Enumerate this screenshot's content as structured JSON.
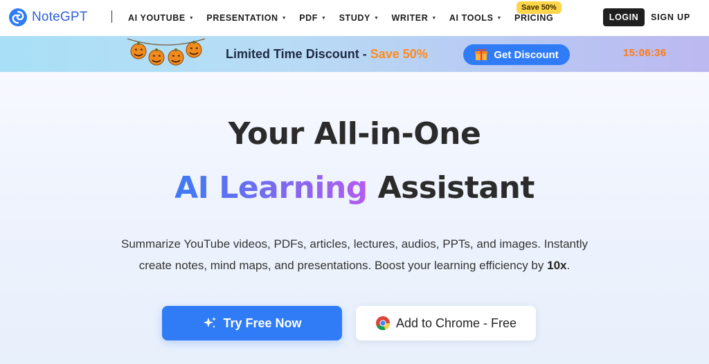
{
  "brand": {
    "name": "NoteGPT"
  },
  "nav": {
    "items": [
      {
        "label": "AI YOUTUBE",
        "has_dropdown": true
      },
      {
        "label": "PRESENTATION",
        "has_dropdown": true
      },
      {
        "label": "PDF",
        "has_dropdown": true
      },
      {
        "label": "STUDY",
        "has_dropdown": true
      },
      {
        "label": "WRITER",
        "has_dropdown": true
      },
      {
        "label": "AI TOOLS",
        "has_dropdown": true
      },
      {
        "label": "PRICING",
        "has_dropdown": false
      }
    ],
    "pricing_badge": "Save 50%",
    "login": "LOGIN",
    "signup": "SIGN UP"
  },
  "promo": {
    "text": "Limited Time Discount - ",
    "highlight": "Save 50%",
    "button": "Get Discount",
    "timer": "15:06:36",
    "decoration_icon": "halloween-pumpkins",
    "button_icon": "gift-icon"
  },
  "hero": {
    "title_line1": "Your All-in-One",
    "title_gradient": "AI Learning",
    "title_rest": " Assistant",
    "subtitle_line1": "Summarize YouTube videos, PDFs, articles, lectures, audios, PPTs, and images. Instantly",
    "subtitle_line2_prefix": "create notes, mind maps, and presentations. Boost your learning efficiency by ",
    "subtitle_line2_bold": "10x",
    "subtitle_line2_suffix": ".",
    "primary_button": "Try Free Now",
    "primary_icon": "sparkle-icon",
    "secondary_button": "Add to Chrome - Free",
    "secondary_icon": "chrome-icon"
  },
  "colors": {
    "accent_blue": "#2f7cf6",
    "promo_orange": "#ff8a1c",
    "badge_yellow": "#ffd54a",
    "gradient_start": "#3d7bf5",
    "gradient_end": "#b45cf0"
  }
}
